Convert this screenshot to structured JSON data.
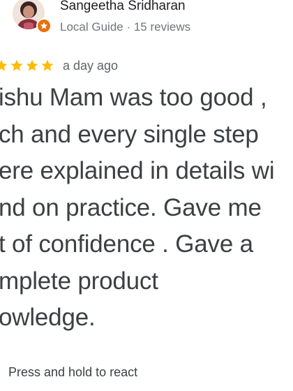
{
  "reviewer": {
    "name": "Sangeetha Sridharan",
    "meta": "Local Guide · 15 reviews",
    "avatar_icon": "profile-photo",
    "badge_icon": "local-guide-star-icon",
    "badge_color": "#e8710a"
  },
  "review": {
    "rating": 5,
    "star_color": "#fbbc04",
    "time": "a day ago",
    "text": "ishu Mam was too good ,\nch and every single step\nere explained in details wi\nnd on practice.  Gave me\nt of confidence  . Gave a\nmplete product\nowledge."
  },
  "footer": {
    "react_hint": "Press and hold to react"
  }
}
